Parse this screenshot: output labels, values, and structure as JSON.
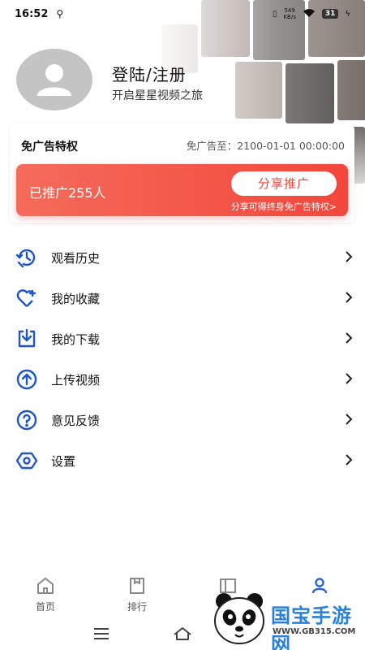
{
  "status_bar": {
    "time": "16:52",
    "usb_icon": "usb-icon",
    "net_speed": "549",
    "net_unit": "KB/s",
    "battery": "31"
  },
  "profile": {
    "title": "登陆/注册",
    "subtitle": "开启星星视频之旅",
    "avatar_icon": "user-avatar-icon"
  },
  "ad_card": {
    "title": "免广告特权",
    "expire": "免广告至：2100-01-01 00:00:00",
    "promoted_count": "已推广255人",
    "share_button": "分享推广",
    "share_hint": "分享可得终身免广告特权>"
  },
  "menu": {
    "items": [
      {
        "label": "观看历史",
        "icon": "history-icon"
      },
      {
        "label": "我的收藏",
        "icon": "favorite-heart-icon"
      },
      {
        "label": "我的下载",
        "icon": "download-icon"
      },
      {
        "label": "上传视频",
        "icon": "upload-icon"
      },
      {
        "label": "意见反馈",
        "icon": "feedback-question-icon"
      },
      {
        "label": "设置",
        "icon": "settings-icon"
      }
    ]
  },
  "tabs": {
    "items": [
      {
        "label": "首页",
        "icon": "home-icon"
      },
      {
        "label": "排行",
        "icon": "ranking-icon"
      },
      {
        "label": "",
        "icon": "category-icon"
      },
      {
        "label": "",
        "icon": "profile-icon"
      }
    ]
  },
  "watermark": {
    "text": "国宝手游网",
    "url": "WWW.GB315.COM"
  },
  "colors": {
    "accent_red": "#f2473c",
    "icon_blue": "#1e56c8",
    "active_tab": "#2a63d4"
  }
}
